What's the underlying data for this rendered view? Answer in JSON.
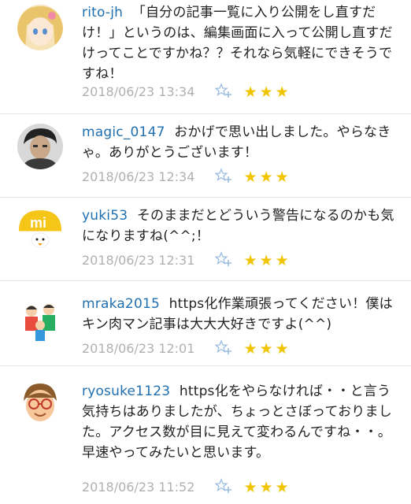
{
  "comments": [
    {
      "user": "rito-jh",
      "text": "「自分の記事一覧に入り公開をし直すだけ！」というのは、編集画面に入って公開し直すだけってことですかね？？それなら気軽にできそうですね！",
      "timestamp": "2018/06/23 13:34",
      "stars": "★★★",
      "avatar_icon": "anime-girl-avatar"
    },
    {
      "user": "magic_0147",
      "text": "おかげで思い出しました。やらなきゃ。ありがとうございます！",
      "timestamp": "2018/06/23 12:34",
      "stars": "★★★",
      "avatar_icon": "man-photo-avatar"
    },
    {
      "user": "yuki53",
      "text": "そのままだとどういう警告になるのかも気になりますね(^^;！",
      "timestamp": "2018/06/23 12:31",
      "stars": "★★★",
      "avatar_icon": "yellow-mi-avatar"
    },
    {
      "user": "mraka2015",
      "text": "https化作業頑張ってください！僕はキン肉マン記事は大大大好きですよ(^^)",
      "timestamp": "2018/06/23 12:01",
      "stars": "★★★",
      "avatar_icon": "family-avatar"
    },
    {
      "user": "ryosuke1123",
      "text": "https化をやらなければ・・と言う気持ちはありましたが、ちょっとさぼっておりました。アクセス数が目に見えて変わるんですね・・。早速やってみたいと思います。",
      "timestamp": "2018/06/23 11:52",
      "stars": "★★★",
      "avatar_icon": "glasses-boy-avatar"
    }
  ],
  "colors": {
    "username": "#1f6fb0",
    "meta": "#b0b0b0",
    "star": "#f0c400",
    "add_star_icon": "#9bbce0"
  }
}
